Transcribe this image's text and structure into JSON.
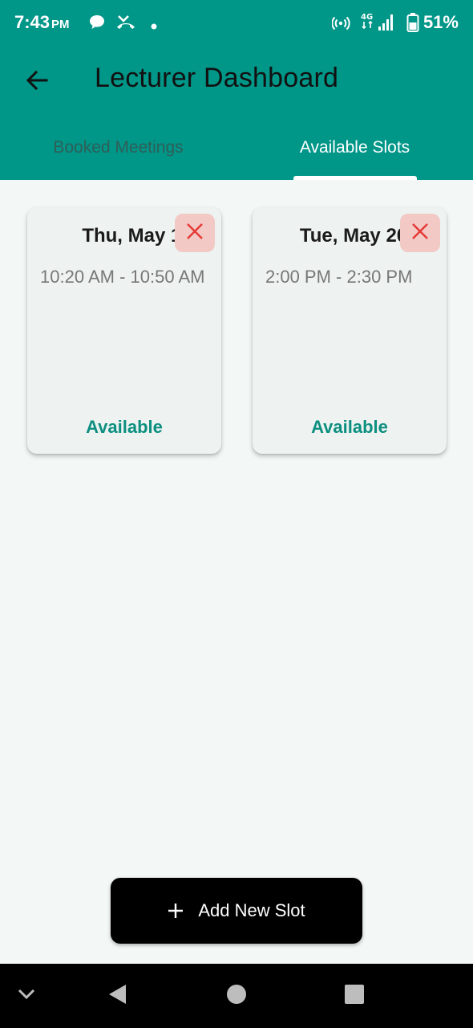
{
  "status_bar": {
    "time": "7:43",
    "ampm": "PM",
    "network": "4G",
    "battery": "51%",
    "icons": [
      "chat-icon",
      "missed-call-icon",
      "notification-dot-icon",
      "hotspot-icon",
      "network-4g-icon",
      "signal-icon",
      "battery-icon"
    ]
  },
  "app_bar": {
    "title": "Lecturer Dashboard",
    "back_icon": "arrow-back-icon"
  },
  "tabs": [
    {
      "label": "Booked Meetings",
      "selected": false
    },
    {
      "label": "Available Slots",
      "selected": true
    }
  ],
  "slots": [
    {
      "date": "Thu, May 15",
      "time": "10:20 AM - 10:50 AM",
      "status": "Available"
    },
    {
      "date": "Tue, May 20",
      "time": "2:00 PM - 2:30 PM",
      "status": "Available"
    }
  ],
  "add_button": {
    "label": "Add New Slot",
    "icon": "plus-icon"
  },
  "nav_bar": {
    "icons": [
      "chevron-down-icon",
      "back-triangle-icon",
      "home-circle-icon",
      "recents-square-icon"
    ]
  },
  "colors": {
    "primary": "#009688",
    "background": "#f3f8f6",
    "card": "#eef3f1",
    "available_text": "#0d8f80",
    "delete_bg": "#f2c9c5",
    "delete_icon": "#e53935"
  }
}
